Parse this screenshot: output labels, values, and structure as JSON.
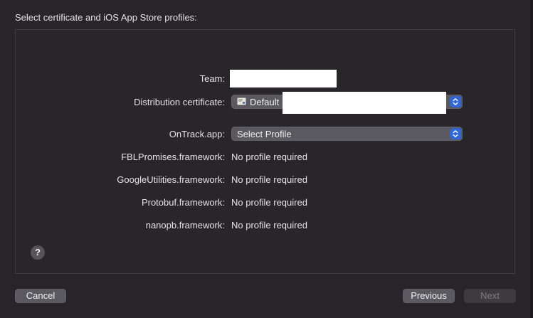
{
  "header": {
    "title": "Select certificate and iOS App Store profiles:"
  },
  "form": {
    "team_label": "Team:",
    "distribution_certificate_label": "Distribution certificate:",
    "distribution_certificate_value": "Default",
    "app_label": "OnTrack.app:",
    "app_profile_value": "Select Profile",
    "frameworks": [
      {
        "label": "FBLPromises.framework:",
        "value": "No profile required"
      },
      {
        "label": "GoogleUtilities.framework:",
        "value": "No profile required"
      },
      {
        "label": "Protobuf.framework:",
        "value": "No profile required"
      },
      {
        "label": "nanopb.framework:",
        "value": "No profile required"
      }
    ]
  },
  "help": {
    "symbol": "?"
  },
  "footer": {
    "cancel_label": "Cancel",
    "previous_label": "Previous",
    "next_label": "Next"
  },
  "colors": {
    "background": "#27242a",
    "popup": "#5b5960",
    "accent": "#2f67d8"
  }
}
